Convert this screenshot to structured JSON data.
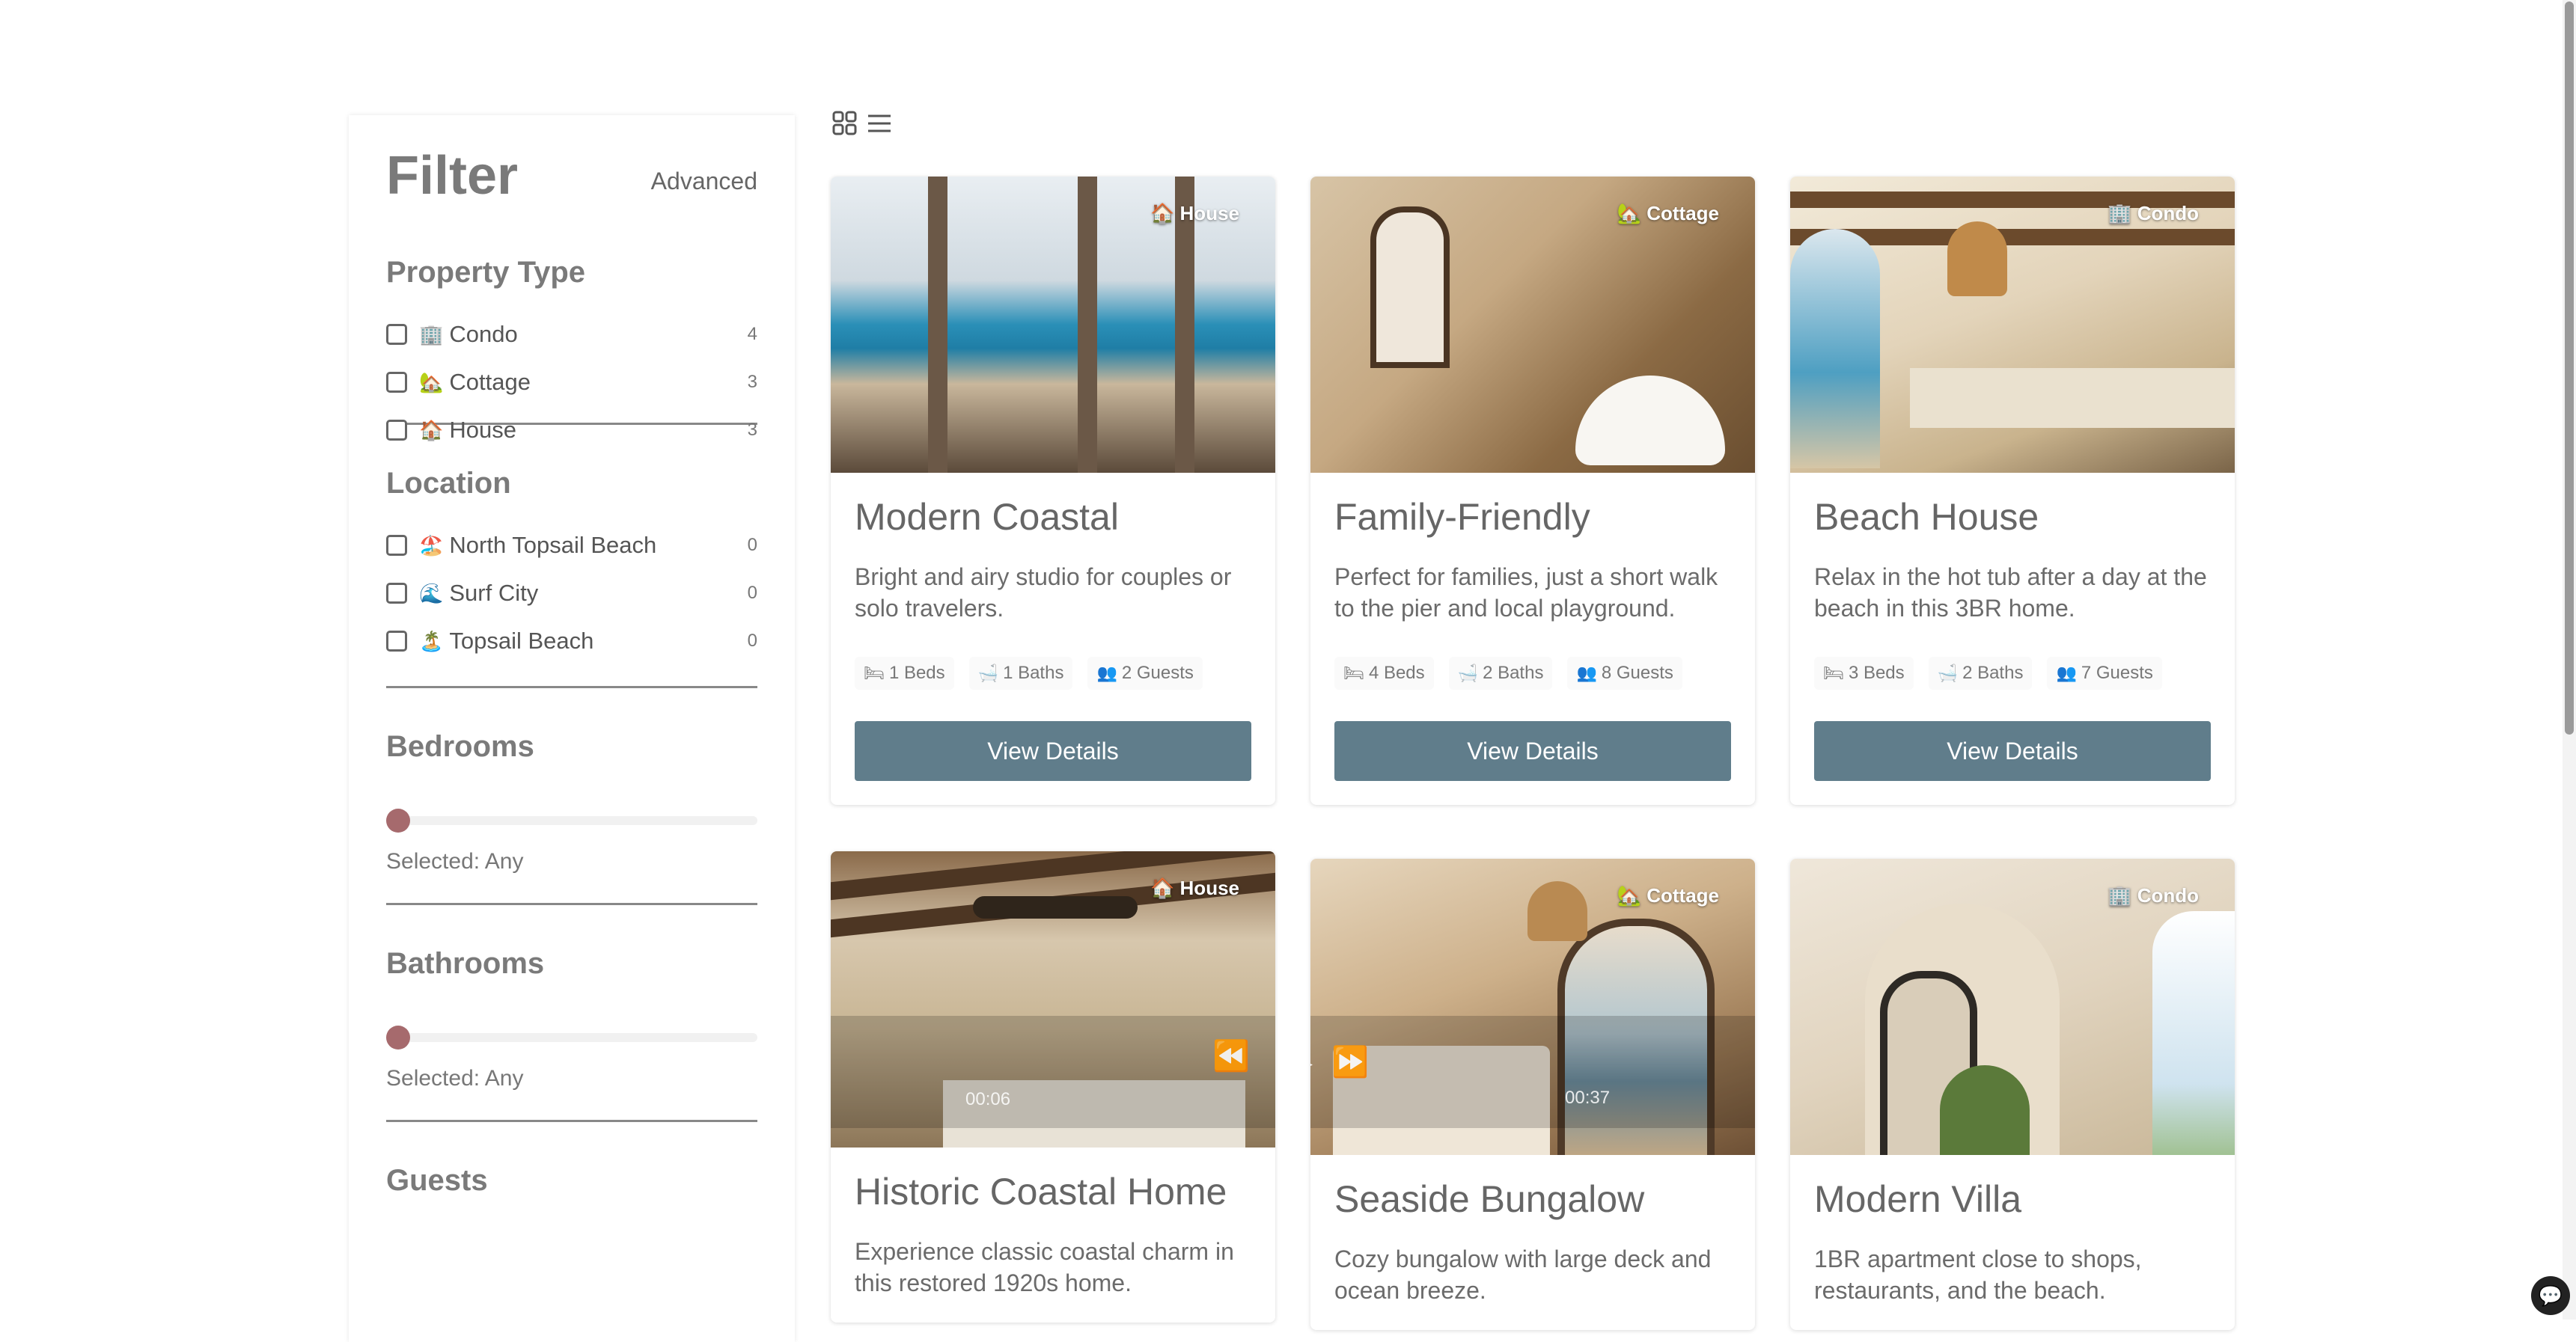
{
  "filter": {
    "title": "Filter",
    "advanced_label": "Advanced",
    "property_type": {
      "title": "Property Type",
      "options": [
        {
          "emoji": "🏢",
          "label": "Condo",
          "count": "4"
        },
        {
          "emoji": "🏡",
          "label": "Cottage",
          "count": "3"
        },
        {
          "emoji": "🏠",
          "label": "House",
          "count": "3"
        }
      ]
    },
    "location": {
      "title": "Location",
      "options": [
        {
          "emoji": "🏖️",
          "label": "North Topsail Beach",
          "count": "0"
        },
        {
          "emoji": "🌊",
          "label": "Surf City",
          "count": "0"
        },
        {
          "emoji": "🏝️",
          "label": "Topsail Beach",
          "count": "0"
        }
      ]
    },
    "bedrooms": {
      "title": "Bedrooms",
      "selected": "Selected: Any"
    },
    "bathrooms": {
      "title": "Bathrooms",
      "selected": "Selected: Any"
    },
    "guests": {
      "title": "Guests"
    }
  },
  "view_toggle": {
    "grid_icon": "grid-icon",
    "list_icon": "list-icon"
  },
  "cards": [
    {
      "badge": "🏠 House",
      "title": "Modern Coastal",
      "desc": "Bright and airy studio for couples or solo travelers.",
      "beds": "1 Beds",
      "baths": "1 Baths",
      "guests": "2 Guests",
      "button": "View Details"
    },
    {
      "badge": "🏡 Cottage",
      "title": "Family-Friendly",
      "desc": "Perfect for families, just a short walk to the pier and local playground.",
      "beds": "4 Beds",
      "baths": "2 Baths",
      "guests": "8 Guests",
      "button": "View Details"
    },
    {
      "badge": "🏢 Condo",
      "title": "Beach House",
      "desc": "Relax in the hot tub after a day at the beach in this 3BR home.",
      "beds": "3 Beds",
      "baths": "2 Baths",
      "guests": "7 Guests",
      "button": "View Details"
    },
    {
      "badge": "🏠 House",
      "title": "Historic Coastal Home",
      "desc": "Experience classic coastal charm in this restored 1920s home."
    },
    {
      "badge": "🏡 Cottage",
      "title": "Seaside Bungalow",
      "desc": "Cozy bungalow with large deck and ocean breeze."
    },
    {
      "badge": "🏢 Condo",
      "title": "Modern Villa",
      "desc": "1BR apartment close to shops, restaurants, and the beach."
    }
  ],
  "video": {
    "time_current": "00:06",
    "time_total": "00:37"
  },
  "icons": {
    "beds": "bed-icon",
    "baths": "bath-icon",
    "guests": "guests-icon"
  }
}
